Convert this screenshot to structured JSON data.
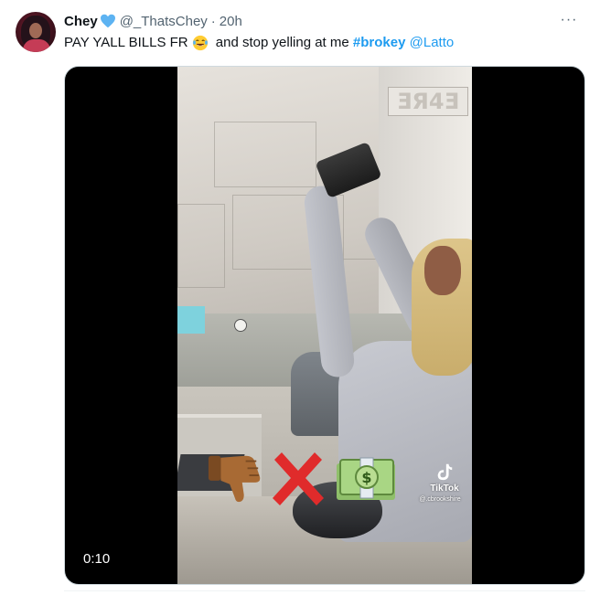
{
  "tweet": {
    "author": {
      "display_name": "Chey",
      "handle": "@_ThatsChey",
      "separator": "·",
      "time": "20h",
      "verified_icon": "blue-heart-icon",
      "avatar_icon": "profile-avatar"
    },
    "more_label": "···",
    "text": {
      "part1": "PAY YALL BILLS FR",
      "emoji": "laughing-tears-emoji",
      "part2": " and stop yelling at me ",
      "hashtag": "#brokey",
      "space": " ",
      "mention": "@Latto"
    },
    "media": {
      "type": "video",
      "duration": "0:10",
      "watermark_label": "TikTok",
      "watermark_user": "@.cbrookshire",
      "pillar_sign": "ƎЯ4Ǝ",
      "overlay_emojis": [
        "thumbs-down-emoji",
        "cross-mark-emoji",
        "money-with-wings-emoji"
      ]
    }
  },
  "colors": {
    "link": "#1d9bf0",
    "secondary_text": "#536471",
    "primary_text": "#0f1419",
    "media_background": "#000000"
  }
}
